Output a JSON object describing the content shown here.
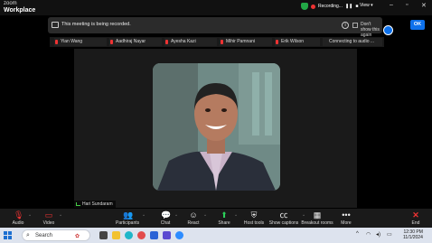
{
  "app": {
    "logo_top": "zoom",
    "logo_bottom": "Workplace"
  },
  "titlebar": {
    "recording_label": "Recording...",
    "view_label": "View"
  },
  "banner": {
    "message": "This meeting is being recorded.",
    "dont_show_label": "Don't show this again",
    "ok_label": "OK"
  },
  "participants": [
    {
      "name": "Yian Wang"
    },
    {
      "name": "Aadhiraj Nayar"
    },
    {
      "name": "Ayesha Kazi"
    },
    {
      "name": "Mihir Pamnani"
    },
    {
      "name": "Erik Wilson"
    },
    {
      "name": "Connecting to audio ..."
    }
  ],
  "stage": {
    "speaker_name": "Hari Sundaram"
  },
  "toolbar": {
    "audio": "Audio",
    "video": "Video",
    "participants": "Participants",
    "participants_count": "21",
    "chat": "Chat",
    "react": "React",
    "share": "Share",
    "host_tools": "Host tools",
    "captions": "Show captions",
    "breakout": "Breakout rooms",
    "more": "More",
    "end": "End"
  },
  "taskbar": {
    "search_placeholder": "Search",
    "time": "12:30 PM",
    "date": "11/1/2024"
  },
  "colors": {
    "accent": "#0e71eb",
    "recording": "#e33333",
    "end": "#e33333",
    "secure": "#22a846"
  }
}
